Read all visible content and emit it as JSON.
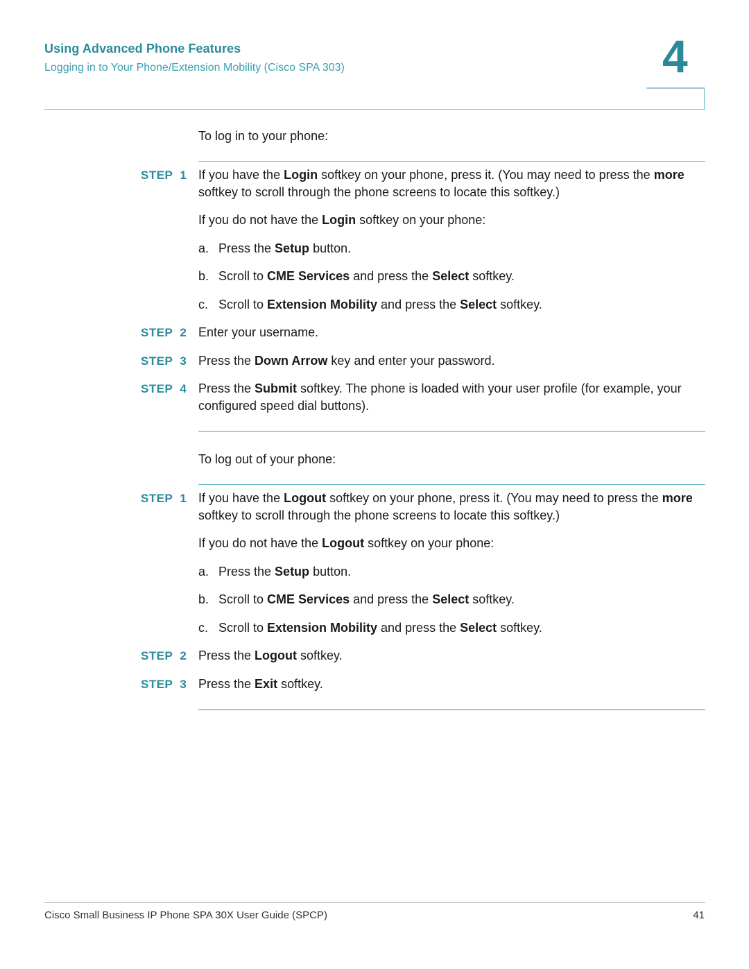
{
  "header": {
    "chapter_title": "Using Advanced Phone Features",
    "section_title": "Logging in to Your Phone/Extension Mobility (Cisco SPA 303)",
    "chapter_number": "4"
  },
  "login": {
    "intro": "To log in to your phone:",
    "steps": [
      {
        "label": "STEP",
        "number": "1",
        "parts": [
          "If you have the ",
          "Login",
          " softkey on your phone, press it. (You may need to press the ",
          "more",
          " softkey to scroll through the phone screens to locate this softkey.)"
        ],
        "alt_intro_parts": [
          "If you do not have the ",
          "Login",
          " softkey on your phone:"
        ],
        "sub_items": [
          {
            "letter": "a.",
            "parts": [
              "Press the ",
              "Setup",
              " button."
            ]
          },
          {
            "letter": "b.",
            "parts": [
              "Scroll to ",
              "CME Services",
              " and press the ",
              "Select",
              " softkey."
            ]
          },
          {
            "letter": "c.",
            "parts": [
              "Scroll to ",
              "Extension Mobility",
              " and press the ",
              "Select",
              " softkey."
            ]
          }
        ]
      },
      {
        "label": "STEP",
        "number": "2",
        "parts": [
          "Enter your username."
        ]
      },
      {
        "label": "STEP",
        "number": "3",
        "parts": [
          "Press the ",
          "Down Arrow",
          " key and enter your password."
        ]
      },
      {
        "label": "STEP",
        "number": "4",
        "parts": [
          "Press the ",
          "Submit",
          " softkey. The phone is loaded with your user profile (for example, your configured speed dial buttons)."
        ]
      }
    ]
  },
  "logout": {
    "intro": "To log out of your phone:",
    "steps": [
      {
        "label": "STEP",
        "number": "1",
        "parts": [
          "If you have the ",
          "Logout",
          " softkey on your phone, press it. (You may need to press the ",
          "more",
          " softkey to scroll through the phone screens to locate this softkey.)"
        ],
        "alt_intro_parts": [
          "If you do not have the ",
          "Logout",
          " softkey on your phone:"
        ],
        "sub_items": [
          {
            "letter": "a.",
            "parts": [
              "Press the ",
              "Setup",
              " button."
            ]
          },
          {
            "letter": "b.",
            "parts": [
              "Scroll to ",
              "CME Services",
              " and press the ",
              "Select",
              " softkey."
            ]
          },
          {
            "letter": "c.",
            "parts": [
              "Scroll to ",
              "Extension Mobility",
              " and press the ",
              "Select",
              " softkey."
            ]
          }
        ]
      },
      {
        "label": "STEP",
        "number": "2",
        "parts": [
          "Press the ",
          "Logout",
          " softkey."
        ]
      },
      {
        "label": "STEP",
        "number": "3",
        "parts": [
          "Press the ",
          "Exit",
          " softkey."
        ]
      }
    ]
  },
  "footer": {
    "title": "Cisco Small Business IP Phone SPA 30X User Guide (SPCP)",
    "page_number": "41"
  }
}
